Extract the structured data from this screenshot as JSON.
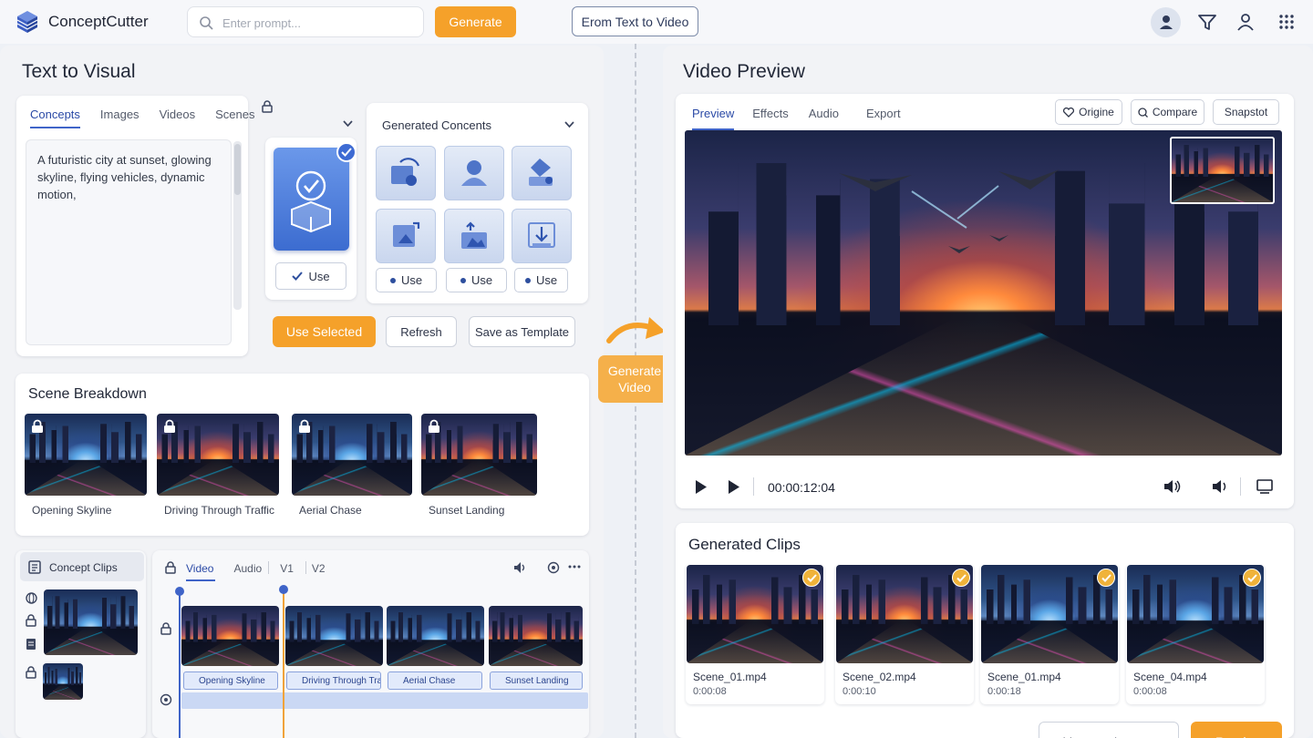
{
  "app": {
    "title": "ConceptCutter"
  },
  "topbar": {
    "prompt_placeholder": "Enter prompt...",
    "generate_label": "Generate",
    "mode_label": "Erom Text to Video"
  },
  "left": {
    "title": "Text to Visual",
    "input_tabs": [
      "Concepts",
      "Images",
      "Videos",
      "Scenes"
    ],
    "prompt_text": "A futuristic city at sunset, glowing skyline, flying vehicles, dynamic motion,",
    "generated_title": "Generated Concents",
    "use_label": "Use",
    "use_selected_label": "Use Selected",
    "refresh_label": "Refresh",
    "save_template_label": "Save as Template",
    "scene_breakdown_title": "Scene Breakdown",
    "scenes": [
      "Opening Skyline",
      "Driving Through Traffic",
      "Aerial Chase",
      "Sunset Landing"
    ],
    "concept_clips_label": "Concept Clips",
    "timeline_tabs": [
      "Video",
      "Audio",
      "V1",
      "V2"
    ],
    "timeline_clips": [
      "Opening Skyline",
      "Driving Through Traffic",
      "Aerial Chase",
      "Sunset Landing"
    ]
  },
  "center": {
    "generate_video_label": "Generate Video"
  },
  "right": {
    "title": "Video Preview",
    "tabs": [
      "Preview",
      "Effects",
      "Audio",
      "Export"
    ],
    "origine_label": "Origine",
    "compare_label": "Compare",
    "snapshot_label": "Snapstot",
    "timecode": "00:00:12:04",
    "clips_title": "Generated Clips",
    "clips": [
      {
        "name": "Scene_01.mp4",
        "duration": "0:00:08"
      },
      {
        "name": "Scene_02.mp4",
        "duration": "0:00:10"
      },
      {
        "name": "Scene_01.mp4",
        "duration": "0:00:18"
      },
      {
        "name": "Scene_04.mp4",
        "duration": "0:00:08"
      }
    ],
    "add_queue_label": "Add to Render Queue",
    "render_label": "Render"
  },
  "colors": {
    "accent": "#f5a12a",
    "primary": "#3f64c8"
  }
}
